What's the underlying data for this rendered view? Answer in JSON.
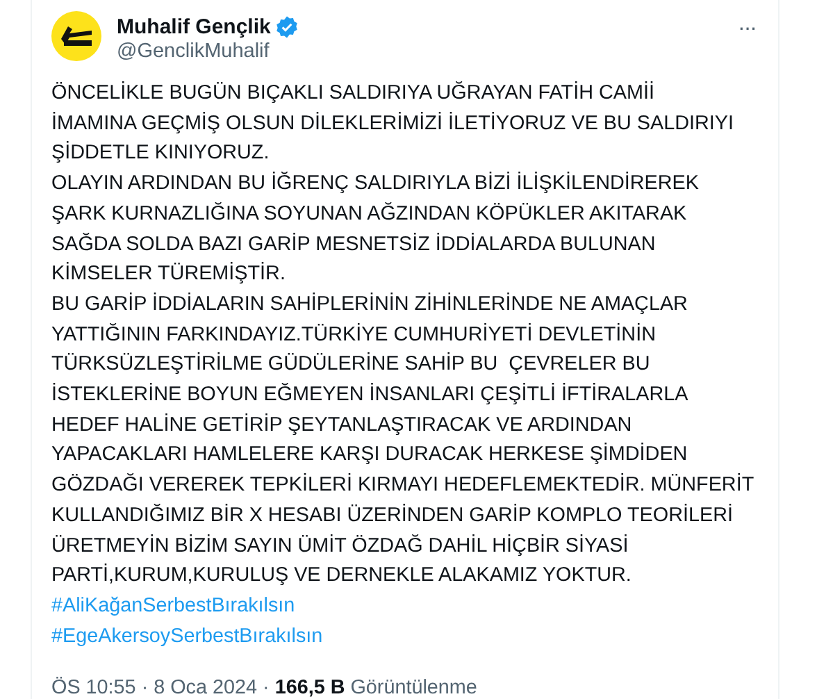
{
  "author": {
    "name": "Muhalif Gençlik",
    "handle": "@GenclikMuhalif",
    "verified": true
  },
  "more": "···",
  "body_lines": [
    "ÖNCELİKLE BUGÜN BIÇAKLI SALDIRIYA UĞRAYAN FATİH CAMİİ",
    "İMAMINA GEÇMİŞ OLSUN DİLEKLERİMİZİ İLETİYORUZ VE BU SALDIRIYI",
    "ŞİDDETLE KINIYORUZ.",
    "OLAYIN ARDINDAN BU İĞRENÇ SALDIRIYLA BİZİ İLİŞKİLENDİREREK",
    "ŞARK KURNAZLIĞINA SOYUNAN AĞZINDAN KÖPÜKLER AKITARAK",
    "SAĞDA SOLDA BAZI GARİP MESNETSİZ İDDİALARDA BULUNAN",
    "KİMSELER TÜREMİŞTİR.",
    "BU GARİP İDDİALARIN SAHİPLERİNİN ZİHİNLERİNDE NE AMAÇLAR",
    "YATTIĞININ FARKINDAYIZ.TÜRKİYE CUMHURİYETİ DEVLETİNİN",
    "TÜRKSÜZLEŞTİRİLME GÜDÜLERİNE SAHİP BU  ÇEVRELER BU",
    "İSTEKLERİNE BOYUN EĞMEYEN İNSANLARI ÇEŞİTLİ İFTİRALARLA",
    "HEDEF HALİNE GETİRİP ŞEYTANLAŞTIRACAK VE ARDINDAN",
    "YAPACAKLARI HAMLELERE KARŞI DURACAK HERKESE ŞİMDİDEN",
    "GÖZDAĞI VEREREK TEPKİLERİ KIRMAYI HEDEFLEMEKTEDİR. MÜNFERİT",
    "KULLANDIĞIMIZ BİR X HESABI ÜZERİNDEN GARİP KOMPLO TEORİLERİ",
    "ÜRETMEYİN BİZİM SAYIN ÜMİT ÖZDAĞ DAHİL HİÇBİR SİYASİ",
    "PARTİ,KURUM,KURULUŞ VE DERNEKLE ALAKAMIZ YOKTUR."
  ],
  "hashtags": [
    "#AliKağanSerbestBırakılsın",
    "#EgeAkersoySerbestBırakılsın"
  ],
  "time": "ÖS 10:55",
  "separator_1": "·",
  "date": "8 Oca 2024",
  "separator_2": "·",
  "views": "166,5 B",
  "views_label": "Görüntülenme"
}
